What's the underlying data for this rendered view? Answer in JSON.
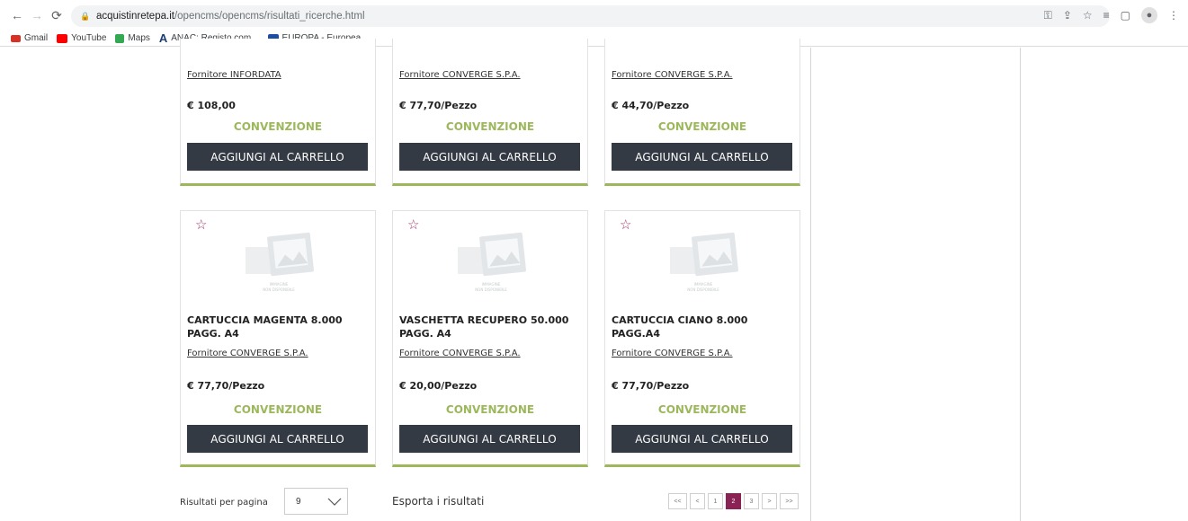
{
  "browser": {
    "url_host": "acquistinretepa.it",
    "url_path": "/opencms/opencms/risultati_ricerche.html",
    "bookmarks": [
      {
        "label": "Gmail",
        "color": "#d93025"
      },
      {
        "label": "YouTube",
        "color": "#ff0000"
      },
      {
        "label": "Maps",
        "color": "#34a853"
      },
      {
        "label": "ANAC: Registo com...",
        "color": "#1a3c73"
      },
      {
        "label": "EUROPA - Europea...",
        "color": "#1f4ea1"
      }
    ]
  },
  "image_placeholder": {
    "line1": "IMMAGINE",
    "line2": "NON DISPONIBILE"
  },
  "products": [
    {
      "supplier": "Fornitore INFORDATA",
      "price": "€ 108,00",
      "badge": "CONVENZIONE",
      "cta": "AGGIUNGI AL CARRELLO"
    },
    {
      "supplier": "Fornitore CONVERGE S.P.A.",
      "price": "€ 77,70/Pezzo",
      "badge": "CONVENZIONE",
      "cta": "AGGIUNGI AL CARRELLO"
    },
    {
      "supplier": "Fornitore CONVERGE S.P.A.",
      "price": "€ 44,70/Pezzo",
      "badge": "CONVENZIONE",
      "cta": "AGGIUNGI AL CARRELLO"
    },
    {
      "title": "CARTUCCIA MAGENTA 8.000 PAGG. A4",
      "supplier": "Fornitore CONVERGE S.P.A.",
      "price": "€ 77,70/Pezzo",
      "badge": "CONVENZIONE",
      "cta": "AGGIUNGI AL CARRELLO"
    },
    {
      "title": "VASCHETTA RECUPERO 50.000 PAGG. A4",
      "supplier": "Fornitore CONVERGE S.P.A.",
      "price": "€ 20,00/Pezzo",
      "badge": "CONVENZIONE",
      "cta": "AGGIUNGI AL CARRELLO"
    },
    {
      "title": "CARTUCCIA CIANO 8.000 PAGG.A4",
      "supplier": "Fornitore CONVERGE S.P.A.",
      "price": "€ 77,70/Pezzo",
      "badge": "CONVENZIONE",
      "cta": "AGGIUNGI AL CARRELLO"
    }
  ],
  "footer": {
    "results_per_page_label": "Risultati per pagina",
    "results_per_page_value": "9",
    "export_label": "Esporta i risultati",
    "pager": {
      "first": "<<",
      "prev": "<",
      "pages": [
        "1",
        "2",
        "3"
      ],
      "current": "2",
      "next": ">",
      "last": ">>"
    }
  },
  "colors": {
    "accent_green": "#9cb85b",
    "button_dark": "#343a44",
    "pager_active": "#8a2353",
    "star": "#a3336b"
  }
}
